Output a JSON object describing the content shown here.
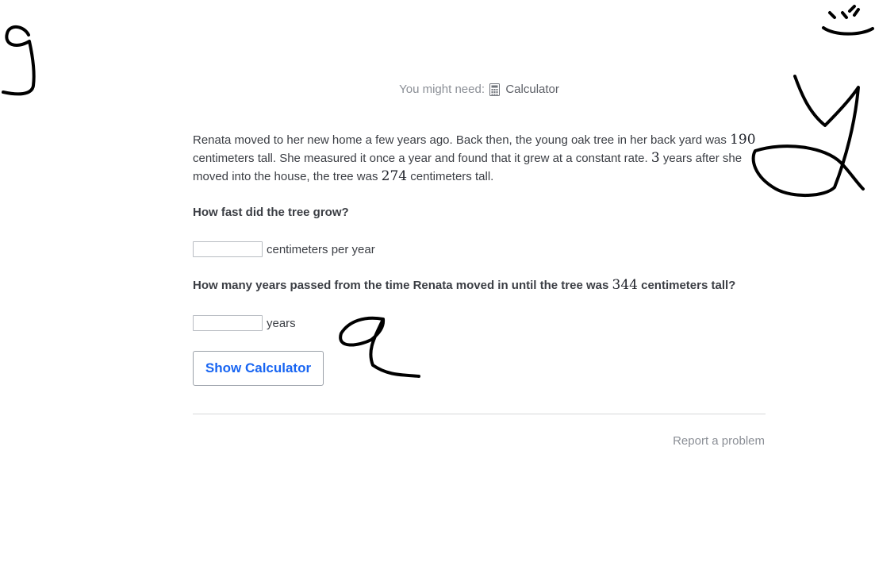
{
  "header": {
    "might_need_label": "You might need:",
    "tool_icon": "calculator-icon",
    "tool_name": "Calculator"
  },
  "problem": {
    "text_part1": "Renata moved to her new home a few years ago. Back then, the young oak tree in her back yard was ",
    "initial_height": "190",
    "text_part2": " centimeters tall. She measured it once a year and found that it grew at a constant rate. ",
    "years_later": "3",
    "text_part3": " years after she moved into the house, the tree was ",
    "later_height": "274",
    "text_part4": " centimeters tall."
  },
  "question1": {
    "prompt": "How fast did the tree grow?",
    "answer_value": "",
    "unit": "centimeters per year"
  },
  "question2": {
    "prompt_part1": "How many years passed from the time Renata moved in until the tree was ",
    "target_height": "344",
    "prompt_part2": " centimeters tall?",
    "answer_value": "",
    "unit": "years"
  },
  "buttons": {
    "show_calculator_label": "Show Calculator"
  },
  "footer": {
    "report_label": "Report a problem"
  },
  "colors": {
    "accent": "#1865f2",
    "muted_text": "#8b8f96",
    "body_text": "#3b3e44",
    "ink": "#000000"
  }
}
